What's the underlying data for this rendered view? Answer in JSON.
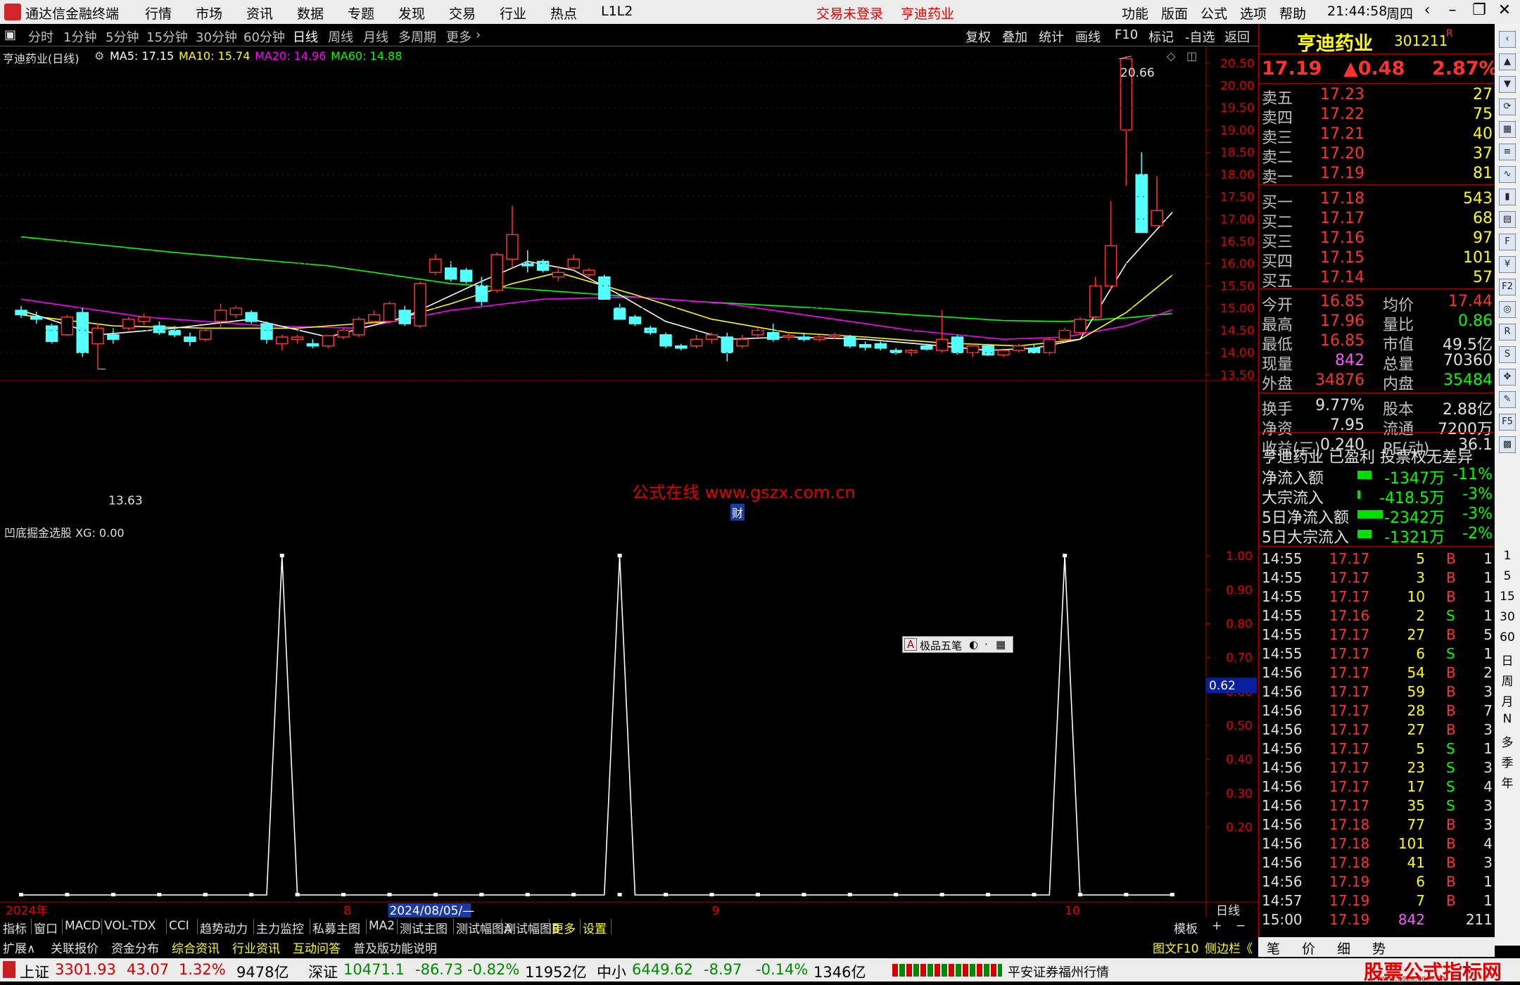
{
  "titlebar": {
    "app_name": "通达信金融终端",
    "menus": [
      "行情",
      "市场",
      "资讯",
      "数据",
      "专题",
      "发现",
      "交易",
      "行业",
      "热点",
      "L1L2"
    ],
    "login_status": "交易未登录",
    "stock_name": "亨迪药业",
    "right_menus": [
      "功能",
      "版面",
      "公式",
      "选项",
      "帮助"
    ],
    "time": "21:44:58",
    "weekday": "周四"
  },
  "periods": [
    "分时",
    "1分钟",
    "5分钟",
    "15分钟",
    "30分钟",
    "60分钟",
    "日线",
    "周线",
    "月线",
    "多周期",
    "更多"
  ],
  "active_period": "日线",
  "tools": [
    "复权",
    "叠加",
    "统计",
    "画线",
    "F10",
    "标记",
    "-自选",
    "返回"
  ],
  "chart_info": {
    "name": "亨迪药业(日线)",
    "ma5": "MA5: 17.15",
    "ma10": "MA10: 15.74",
    "ma20": "MA20: 14.96",
    "ma60": "MA60: 14.88",
    "high_label": "20.66",
    "low_label": "13.63",
    "watermark": "公式在线  www.gszx.com.cn",
    "cai_label": "财"
  },
  "colors": {
    "up": "#ff3232",
    "down": "#54ffff",
    "ma5": "#ffffff",
    "ma10": "#ffff00",
    "ma20": "#ff00ff",
    "ma60": "#00ff00",
    "axis": "#e00000"
  },
  "chart_data": [
    {
      "type": "candlestick",
      "title": "亨迪药业(日线)",
      "ylim": [
        13.45,
        20.75
      ],
      "yticks": [
        "20.50",
        "20.00",
        "19.50",
        "19.00",
        "18.50",
        "18.00",
        "17.50",
        "17.00",
        "16.50",
        "16.00",
        "15.50",
        "15.00",
        "14.50",
        "14.00",
        "13.50"
      ],
      "candles": [
        [
          14.95,
          15.05,
          14.78,
          14.85
        ],
        [
          14.8,
          14.92,
          14.65,
          14.75
        ],
        [
          14.6,
          14.65,
          14.2,
          14.25
        ],
        [
          14.4,
          14.85,
          14.38,
          14.8
        ],
        [
          14.9,
          15.0,
          13.9,
          14.0
        ],
        [
          14.2,
          14.65,
          13.63,
          14.55
        ],
        [
          14.4,
          14.55,
          14.2,
          14.3
        ],
        [
          14.55,
          14.8,
          14.5,
          14.75
        ],
        [
          14.7,
          14.88,
          14.62,
          14.8
        ],
        [
          14.6,
          14.7,
          14.4,
          14.45
        ],
        [
          14.5,
          14.6,
          14.35,
          14.4
        ],
        [
          14.35,
          14.45,
          14.15,
          14.25
        ],
        [
          14.3,
          14.55,
          14.25,
          14.5
        ],
        [
          14.7,
          15.1,
          14.55,
          14.95
        ],
        [
          14.85,
          15.05,
          14.78,
          15.0
        ],
        [
          14.9,
          14.95,
          14.65,
          14.7
        ],
        [
          14.65,
          14.7,
          14.2,
          14.3
        ],
        [
          14.2,
          14.4,
          14.05,
          14.35
        ],
        [
          14.3,
          14.4,
          14.2,
          14.35
        ],
        [
          14.2,
          14.3,
          14.1,
          14.15
        ],
        [
          14.15,
          14.4,
          14.1,
          14.38
        ],
        [
          14.35,
          14.55,
          14.3,
          14.5
        ],
        [
          14.4,
          14.8,
          14.35,
          14.75
        ],
        [
          14.7,
          14.95,
          14.65,
          14.85
        ],
        [
          14.7,
          15.15,
          14.65,
          15.1
        ],
        [
          14.95,
          15.05,
          14.6,
          14.65
        ],
        [
          14.6,
          15.6,
          14.55,
          15.55
        ],
        [
          15.8,
          16.2,
          15.75,
          16.1
        ],
        [
          15.9,
          16.05,
          15.6,
          15.65
        ],
        [
          15.85,
          15.9,
          15.55,
          15.6
        ],
        [
          15.5,
          15.7,
          15.05,
          15.15
        ],
        [
          15.4,
          16.25,
          15.35,
          16.2
        ],
        [
          16.1,
          17.3,
          15.9,
          16.65
        ],
        [
          16.0,
          16.3,
          15.8,
          15.95
        ],
        [
          16.05,
          16.1,
          15.8,
          15.85
        ],
        [
          15.7,
          15.95,
          15.6,
          15.8
        ],
        [
          15.9,
          16.2,
          15.85,
          16.1
        ],
        [
          15.75,
          15.9,
          15.7,
          15.85
        ],
        [
          15.7,
          15.75,
          15.2,
          15.2
        ],
        [
          15.0,
          15.1,
          14.75,
          14.75
        ],
        [
          14.8,
          14.85,
          14.6,
          14.65
        ],
        [
          14.55,
          14.6,
          14.4,
          14.45
        ],
        [
          14.4,
          14.45,
          14.1,
          14.15
        ],
        [
          14.15,
          14.2,
          14.05,
          14.1
        ],
        [
          14.15,
          14.4,
          14.1,
          14.3
        ],
        [
          14.3,
          14.45,
          14.2,
          14.4
        ],
        [
          14.35,
          14.45,
          13.8,
          14.0
        ],
        [
          14.15,
          14.4,
          14.1,
          14.3
        ],
        [
          14.4,
          14.55,
          14.35,
          14.5
        ],
        [
          14.45,
          14.65,
          14.25,
          14.3
        ],
        [
          14.35,
          14.45,
          14.28,
          14.38
        ],
        [
          14.35,
          14.42,
          14.25,
          14.3
        ],
        [
          14.3,
          14.4,
          14.25,
          14.35
        ],
        [
          14.38,
          14.45,
          14.3,
          14.4
        ],
        [
          14.35,
          14.4,
          14.1,
          14.15
        ],
        [
          14.18,
          14.25,
          14.05,
          14.12
        ],
        [
          14.2,
          14.25,
          14.05,
          14.1
        ],
        [
          14.05,
          14.1,
          13.95,
          14.0
        ],
        [
          14.0,
          14.08,
          13.92,
          14.05
        ],
        [
          14.15,
          14.2,
          14.05,
          14.08
        ],
        [
          14.05,
          14.95,
          14.0,
          14.3
        ],
        [
          14.35,
          14.4,
          13.95,
          14.0
        ],
        [
          14.0,
          14.2,
          13.9,
          14.15
        ],
        [
          14.15,
          14.2,
          13.92,
          13.95
        ],
        [
          13.95,
          14.1,
          13.9,
          14.05
        ],
        [
          14.05,
          14.2,
          14.0,
          14.15
        ],
        [
          14.1,
          14.2,
          13.98,
          14.0
        ],
        [
          14.0,
          14.35,
          13.95,
          14.3
        ],
        [
          14.3,
          14.55,
          14.25,
          14.5
        ],
        [
          14.45,
          14.8,
          14.4,
          14.75
        ],
        [
          14.8,
          15.7,
          14.75,
          15.5
        ],
        [
          15.5,
          17.4,
          15.4,
          16.4
        ],
        [
          19.0,
          20.66,
          17.75,
          20.6
        ],
        [
          18.0,
          18.5,
          16.7,
          16.7
        ],
        [
          16.85,
          17.96,
          16.85,
          17.19
        ]
      ],
      "ma5_points": [
        [
          0,
          14.95
        ],
        [
          5,
          14.4
        ],
        [
          10,
          14.55
        ],
        [
          15,
          14.75
        ],
        [
          20,
          14.35
        ],
        [
          25,
          14.8
        ],
        [
          30,
          15.6
        ],
        [
          33,
          16.05
        ],
        [
          36,
          15.85
        ],
        [
          39,
          15.3
        ],
        [
          42,
          14.7
        ],
        [
          46,
          14.3
        ],
        [
          50,
          14.35
        ],
        [
          55,
          14.3
        ],
        [
          60,
          14.15
        ],
        [
          63,
          14.05
        ],
        [
          66,
          14.1
        ],
        [
          69,
          14.3
        ],
        [
          72,
          16.0
        ],
        [
          75,
          17.15
        ]
      ],
      "ma10_points": [
        [
          0,
          14.85
        ],
        [
          6,
          14.6
        ],
        [
          12,
          14.55
        ],
        [
          18,
          14.55
        ],
        [
          24,
          14.7
        ],
        [
          28,
          15.1
        ],
        [
          32,
          15.55
        ],
        [
          35,
          15.8
        ],
        [
          40,
          15.3
        ],
        [
          45,
          14.75
        ],
        [
          50,
          14.45
        ],
        [
          55,
          14.35
        ],
        [
          60,
          14.22
        ],
        [
          65,
          14.15
        ],
        [
          69,
          14.3
        ],
        [
          72,
          14.9
        ],
        [
          75,
          15.74
        ]
      ],
      "ma20_points": [
        [
          0,
          15.2
        ],
        [
          8,
          14.8
        ],
        [
          16,
          14.6
        ],
        [
          22,
          14.55
        ],
        [
          28,
          14.95
        ],
        [
          34,
          15.2
        ],
        [
          40,
          15.25
        ],
        [
          46,
          15.1
        ],
        [
          52,
          14.8
        ],
        [
          58,
          14.5
        ],
        [
          64,
          14.3
        ],
        [
          68,
          14.35
        ],
        [
          72,
          14.6
        ],
        [
          75,
          14.96
        ]
      ],
      "ma60_points": [
        [
          0,
          16.6
        ],
        [
          10,
          16.25
        ],
        [
          20,
          15.95
        ],
        [
          28,
          15.55
        ],
        [
          36,
          15.35
        ],
        [
          44,
          15.15
        ],
        [
          52,
          15.0
        ],
        [
          58,
          14.85
        ],
        [
          64,
          14.72
        ],
        [
          68,
          14.7
        ],
        [
          72,
          14.78
        ],
        [
          75,
          14.88
        ]
      ]
    },
    {
      "type": "line",
      "title": "凹底掘金选股",
      "indicator_label": "凹底掘金选股  XG: 0.00",
      "ylim": [
        0,
        1.05
      ],
      "yticks": [
        "1.00",
        "0.90",
        "0.80",
        "0.70",
        "0.60",
        "0.50",
        "0.40",
        "0.30",
        "0.20"
      ],
      "current_value_tag": "0.62",
      "spikes_at": [
        17,
        39,
        68
      ],
      "bar_count": 76
    }
  ],
  "x_axis": {
    "labels": [
      "2024年",
      "8",
      "2024/08/05/—",
      "9",
      "10"
    ],
    "right_label": "日线"
  },
  "indicator_tabs": [
    "指标",
    "窗口",
    "MACD",
    "VOL-TDX",
    "CCI",
    "趋势动力",
    "主力监控",
    "私募主图",
    "MA2",
    "测试主图",
    "测试幅图A",
    "测试幅图B",
    "更多",
    "设置"
  ],
  "indicator_tabs_right": [
    "模板",
    "+",
    "−"
  ],
  "bottom_tabs": [
    "扩展∧",
    "关联报价",
    "资金分布",
    "综合资讯",
    "行业资讯",
    "互动问答",
    "普及版功能说明"
  ],
  "bottom_tabs_right": [
    "图文F10",
    "侧边栏《",
    "笔",
    "价",
    "细",
    "势"
  ],
  "popup": {
    "label": "极品五笔"
  },
  "right_panel": {
    "name": "亨迪药业",
    "code": "301211",
    "r_flag": "R",
    "price": "17.19",
    "change": "▲0.48",
    "pct": "2.87%",
    "asks": [
      [
        "卖五",
        "17.23",
        "27"
      ],
      [
        "卖四",
        "17.22",
        "75"
      ],
      [
        "卖三",
        "17.21",
        "40"
      ],
      [
        "卖二",
        "17.20",
        "37"
      ],
      [
        "卖一",
        "17.19",
        "81"
      ]
    ],
    "bids": [
      [
        "买一",
        "17.18",
        "543"
      ],
      [
        "买二",
        "17.17",
        "68"
      ],
      [
        "买三",
        "17.16",
        "97"
      ],
      [
        "买四",
        "17.15",
        "101"
      ],
      [
        "买五",
        "17.14",
        "57"
      ]
    ],
    "stats1": [
      [
        "今开",
        "16.85",
        "均价",
        "17.44"
      ],
      [
        "最高",
        "17.96",
        "量比",
        "0.86"
      ],
      [
        "最低",
        "16.85",
        "市值",
        "49.5亿"
      ],
      [
        "现量",
        "842",
        "总量",
        "70360"
      ],
      [
        "外盘",
        "34876",
        "内盘",
        "35484"
      ]
    ],
    "stats2": [
      [
        "换手",
        "9.77%",
        "股本",
        "2.88亿"
      ],
      [
        "净资",
        "7.95",
        "流通",
        "7200万"
      ],
      [
        "收益(三)",
        "0.240",
        "PE(动)",
        "36.1"
      ]
    ],
    "profile": "亨迪药业 已盈利 投票权无差异",
    "flows": [
      [
        "净流入额",
        "-1347万",
        "-11%"
      ],
      [
        "大宗流入",
        "-418.5万",
        "-3%"
      ],
      [
        "5日净流入额",
        "-2342万",
        "-3%"
      ],
      [
        "5日大宗流入",
        "-1321万",
        "-2%"
      ]
    ],
    "ticks": [
      [
        "14:55",
        "17.17",
        "5",
        "B",
        "1"
      ],
      [
        "14:55",
        "17.17",
        "3",
        "B",
        "1"
      ],
      [
        "14:55",
        "17.17",
        "10",
        "B",
        "1"
      ],
      [
        "14:55",
        "17.16",
        "2",
        "S",
        "1"
      ],
      [
        "14:55",
        "17.17",
        "27",
        "B",
        "5"
      ],
      [
        "14:55",
        "17.17",
        "6",
        "S",
        "1"
      ],
      [
        "14:56",
        "17.17",
        "54",
        "B",
        "2"
      ],
      [
        "14:56",
        "17.17",
        "59",
        "B",
        "3"
      ],
      [
        "14:56",
        "17.17",
        "28",
        "B",
        "7"
      ],
      [
        "14:56",
        "17.17",
        "27",
        "B",
        "3"
      ],
      [
        "14:56",
        "17.17",
        "5",
        "S",
        "1"
      ],
      [
        "14:56",
        "17.17",
        "23",
        "S",
        "3"
      ],
      [
        "14:56",
        "17.17",
        "17",
        "S",
        "4"
      ],
      [
        "14:56",
        "17.17",
        "35",
        "S",
        "3"
      ],
      [
        "14:56",
        "17.18",
        "77",
        "B",
        "3"
      ],
      [
        "14:56",
        "17.18",
        "101",
        "B",
        "4"
      ],
      [
        "14:56",
        "17.18",
        "41",
        "B",
        "3"
      ],
      [
        "14:56",
        "17.19",
        "6",
        "B",
        "1"
      ],
      [
        "14:57",
        "17.19",
        "7",
        "B",
        "1"
      ],
      [
        "15:00",
        "17.19",
        "842",
        "",
        "211"
      ]
    ]
  },
  "side_icons": [
    "collapse-icon",
    "up-icon",
    "down-icon",
    "refresh-icon",
    "grid-icon",
    "list-icon",
    "chart-icon",
    "candle-icon",
    "table-icon",
    "f10-icon",
    "finance-icon",
    "f2-icon",
    "circle-icon",
    "rsi-icon",
    "s-icon",
    "move-icon",
    "pen-icon",
    "f5-icon",
    "image-icon"
  ],
  "side_periods": [
    "1",
    "5",
    "15",
    "30",
    "60",
    "日",
    "周",
    "月",
    "N",
    "多",
    "季",
    "年"
  ],
  "statusbar": {
    "items": [
      {
        "name": "上证",
        "value": "3301.93",
        "change": "43.07",
        "pct": "1.32%",
        "amount": "9478亿"
      },
      {
        "name": "深证",
        "value": "10471.1",
        "change": "-86.73",
        "pct": "-0.82%",
        "amount": "11952亿"
      },
      {
        "name": "中小",
        "value": "6449.62",
        "change": "-8.97",
        "pct": "-0.14%",
        "amount": "1346亿"
      }
    ],
    "broker": "平安证券福州行情",
    "brand": "股票公式指标网",
    "brand_url": "www.gszx.com.cn"
  }
}
